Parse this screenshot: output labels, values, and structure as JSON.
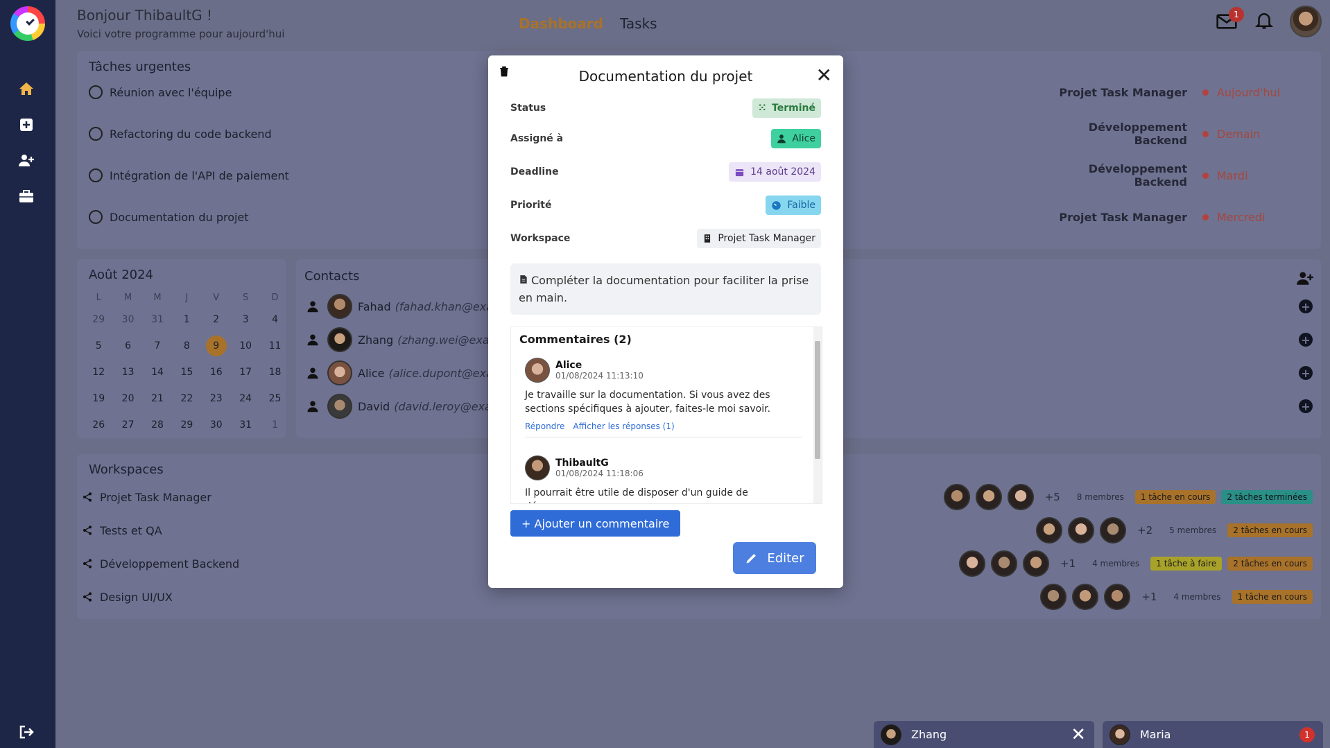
{
  "header": {
    "greeting": "Bonjour ThibaultG !",
    "subtitle": "Voici votre programme pour aujourd'hui",
    "tabs": [
      "Dashboard",
      "Tasks"
    ],
    "mail_badge": "1"
  },
  "urgent": {
    "title": "Tâches urgentes",
    "tasks": [
      {
        "name": "Réunion avec l'équipe",
        "project": "Projet Task Manager",
        "when": "Aujourd'hui"
      },
      {
        "name": "Refactoring du code backend",
        "project": "Développement Backend",
        "when": "Demain"
      },
      {
        "name": "Intégration de l'API de paiement",
        "project": "Développement Backend",
        "when": "Mardi"
      },
      {
        "name": "Documentation du projet",
        "project": "Projet Task Manager",
        "when": "Mercredi"
      }
    ]
  },
  "calendar": {
    "title": "Août 2024",
    "days": [
      "L",
      "M",
      "M",
      "J",
      "V",
      "S",
      "D"
    ],
    "weeks": [
      [
        "29",
        "30",
        "31",
        "1",
        "2",
        "3",
        "4"
      ],
      [
        "5",
        "6",
        "7",
        "8",
        "9",
        "10",
        "11"
      ],
      [
        "12",
        "13",
        "14",
        "15",
        "16",
        "17",
        "18"
      ],
      [
        "19",
        "20",
        "21",
        "22",
        "23",
        "24",
        "25"
      ],
      [
        "26",
        "27",
        "28",
        "29",
        "30",
        "31",
        "1"
      ]
    ],
    "today": "9"
  },
  "contacts": {
    "title": "Contacts",
    "items": [
      {
        "name": "Fahad",
        "email": "(fahad.khan@examp"
      },
      {
        "name": "Zhang",
        "email": "(zhang.wei@examp"
      },
      {
        "name": "Alice",
        "email": "(alice.dupont@examp"
      },
      {
        "name": "David",
        "email": "(david.leroy@examp"
      }
    ]
  },
  "workspaces": {
    "title": "Workspaces",
    "items": [
      {
        "name": "Projet Task Manager",
        "more": "+5",
        "members": "8 membres",
        "badges": [
          {
            "text": "1 tâche en cours",
            "kind": "cours"
          },
          {
            "text": "2 tâches terminées",
            "kind": "done"
          }
        ]
      },
      {
        "name": "Tests et QA",
        "more": "+2",
        "members": "5 membres",
        "badges": [
          {
            "text": "2 tâches en cours",
            "kind": "cours"
          }
        ]
      },
      {
        "name": "Développement Backend",
        "more": "+1",
        "members": "4 membres",
        "badges": [
          {
            "text": "1 tâche à faire",
            "kind": "todo"
          },
          {
            "text": "2 tâches en cours",
            "kind": "cours"
          }
        ]
      },
      {
        "name": "Design UI/UX",
        "more": "+1",
        "members": "4 membres",
        "badges": [
          {
            "text": "1 tâche en cours",
            "kind": "cours"
          }
        ]
      }
    ]
  },
  "modal": {
    "title": "Documentation du projet",
    "status_label": "Status",
    "status": "Terminé",
    "assigned_label": "Assigné à",
    "assigned": "Alice",
    "deadline_label": "Deadline",
    "deadline": "14 août 2024",
    "priority_label": "Priorité",
    "priority": "Faible",
    "workspace_label": "Workspace",
    "workspace": "Projet Task Manager",
    "description": "Compléter la documentation pour faciliter la prise en main.",
    "comments_title": "Commentaires (2)",
    "comments": [
      {
        "author": "Alice",
        "date": "01/08/2024 11:13:10",
        "text": "Je travaille sur la documentation. Si vous avez des sections spécifiques à ajouter, faites-le moi savoir.",
        "reply": "Répondre",
        "show_replies": "Afficher les réponses (1)"
      },
      {
        "author": "ThibaultG",
        "date": "01/08/2024 11:18:06",
        "text": "Il pourrait être utile de disposer d'un guide de démarrage"
      }
    ],
    "add_comment": "+ Ajouter un commentaire",
    "edit": "Editer"
  },
  "chats": [
    {
      "name": "Zhang"
    },
    {
      "name": "Maria",
      "badge": "1"
    }
  ]
}
